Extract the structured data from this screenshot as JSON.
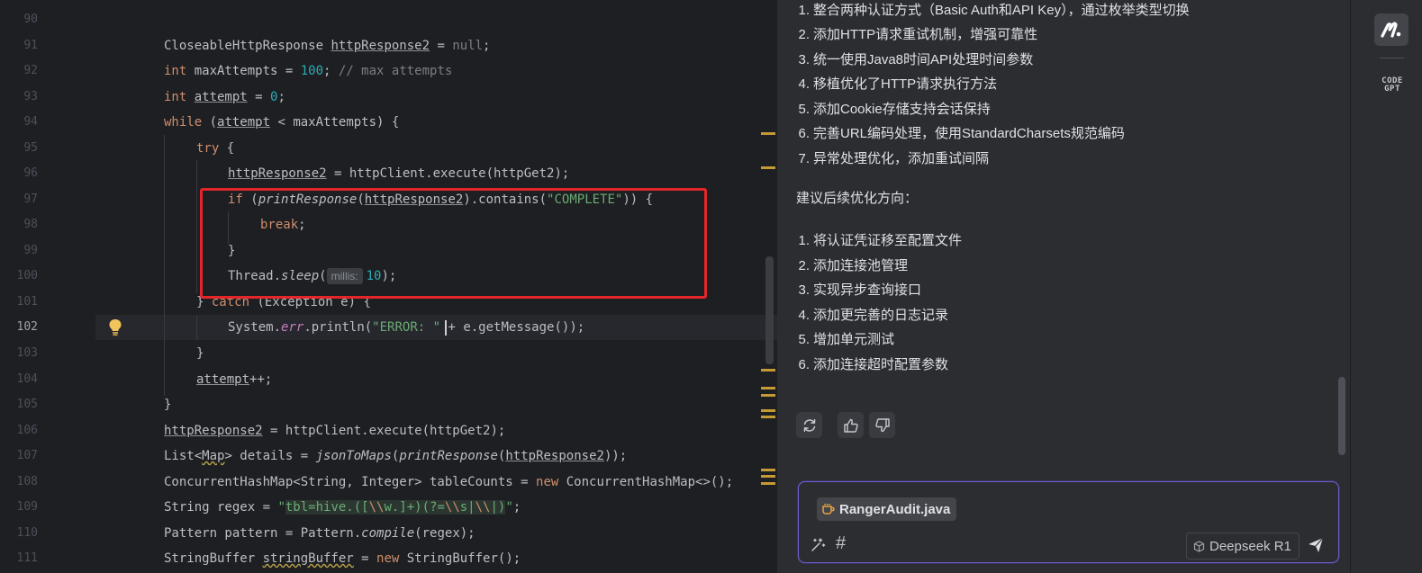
{
  "editor": {
    "line_numbers": [
      "90",
      "91",
      "92",
      "93",
      "94",
      "95",
      "96",
      "97",
      "98",
      "99",
      "100",
      "101",
      "102",
      "103",
      "104",
      "105",
      "106",
      "107",
      "108",
      "109",
      "110",
      "111"
    ],
    "current_line": "102",
    "inlay_hint": "millis:",
    "code_text": {
      "l91_type": "CloseableHttpResponse ",
      "l91_var": "httpResponse2",
      "l91_rest": " = ",
      "l91_null": "null",
      "l91_end": ";",
      "l92_kw": "int ",
      "l92_a": "maxAttempts = ",
      "l92_num": "100",
      "l92_b": "; ",
      "l92_cmt": "// max attempts",
      "l93_kw": "int ",
      "l93_var": "attempt",
      "l93_a": " = ",
      "l93_num": "0",
      "l93_b": ";",
      "l94_kw": "while ",
      "l94_a": "(",
      "l94_var": "attempt",
      "l94_b": " < maxAttempts) {",
      "l95_kw": "try ",
      "l95_a": "{",
      "l96_var": "httpResponse2",
      "l96_a": " = httpClient.execute(httpGet2);",
      "l97_kw": "if ",
      "l97_a": "(",
      "l97_fn": "printResponse",
      "l97_b": "(",
      "l97_var": "httpResponse2",
      "l97_c": ").contains(",
      "l97_str": "\"COMPLETE\"",
      "l97_d": ")) {",
      "l98_kw": "break",
      "l98_a": ";",
      "l99_a": "}",
      "l100_a": "Thread.",
      "l100_fn": "sleep",
      "l100_b": "(",
      "l100_num": "10",
      "l100_c": ");",
      "l101_a": "} ",
      "l101_kw": "catch ",
      "l101_b": "(Exception e) {",
      "l102_a": "System.",
      "l102_field": "err",
      "l102_b": ".println(",
      "l102_str": "\"ERROR: \"",
      "l102_c": " + e.getMessage());",
      "l103_a": "}",
      "l104_var": "attempt",
      "l104_a": "++;",
      "l105_a": "}",
      "l106_var": "httpResponse2",
      "l106_a": " = httpClient.execute(httpGet2);",
      "l107_a": "List<",
      "l107_map": "Map",
      "l107_b": "> details = ",
      "l107_fn1": "jsonToMaps",
      "l107_c": "(",
      "l107_fn2": "printResponse",
      "l107_d": "(",
      "l107_var": "httpResponse2",
      "l107_e": "));",
      "l108_a": "ConcurrentHashMap<String, Integer> tableCounts = ",
      "l108_kw": "new ",
      "l108_b": "ConcurrentHashMap<>();",
      "l109_a": "String regex = ",
      "l109_q1": "\"",
      "l109_r1": "tbl=hive.([",
      "l109_e1": "\\\\",
      "l109_r2": "w.]+)(?=",
      "l109_e2": "\\\\",
      "l109_r3": "s|",
      "l109_e3": "\\\\",
      "l109_r4": "|)",
      "l109_q2": "\"",
      "l109_b": ";",
      "l110_a": "Pattern pattern = Pattern.",
      "l110_fn": "compile",
      "l110_b": "(regex);",
      "l111_a": "StringBuffer ",
      "l111_var": "stringBuffer",
      "l111_b": " = ",
      "l111_kw": "new ",
      "l111_c": "StringBuffer();"
    }
  },
  "chat": {
    "summary_items": [
      {
        "n": "1.",
        "text": "整合两种认证方式（Basic Auth和API Key），通过枚举类型切换"
      },
      {
        "n": "2.",
        "text": "添加HTTP请求重试机制，增强可靠性"
      },
      {
        "n": "3.",
        "text": "统一使用Java8时间API处理时间参数"
      },
      {
        "n": "4.",
        "text": "移植优化了HTTP请求执行方法"
      },
      {
        "n": "5.",
        "text": "添加Cookie存储支持会话保持"
      },
      {
        "n": "6.",
        "text": "完善URL编码处理，使用StandardCharsets规范编码"
      },
      {
        "n": "7.",
        "text": "异常处理优化，添加重试间隔"
      }
    ],
    "suggest_heading": "建议后续优化方向：",
    "suggest_items": [
      {
        "n": "1.",
        "text": "将认证凭证移至配置文件"
      },
      {
        "n": "2.",
        "text": "添加连接池管理"
      },
      {
        "n": "3.",
        "text": "实现异步查询接口"
      },
      {
        "n": "4.",
        "text": "添加更完善的日志记录"
      },
      {
        "n": "5.",
        "text": "增加单元测试"
      },
      {
        "n": "6.",
        "text": "添加连接超时配置参数"
      }
    ],
    "actions": {
      "regenerate_icon": "refresh-icon",
      "like_icon": "thumbs-up-icon",
      "dislike_icon": "thumbs-down-icon"
    },
    "input": {
      "file_chip": "RangerAudit.java",
      "file_icon": "coffee-cup-icon",
      "model": "Deepseek R1",
      "model_icon": "cube-icon",
      "send_icon": "send-icon"
    }
  },
  "toolbar": {
    "plugin_icon_text_top": "CODE",
    "plugin_icon_text_bottom": "GPT"
  },
  "colors": {
    "editor_bg": "#1e1f22",
    "panel_bg": "#2b2d30",
    "keyword": "#cf8e6d",
    "number": "#2aacb8",
    "string": "#6aab73",
    "comment": "#7a7e85",
    "highlight_box": "#e3262a",
    "input_border": "#6c5fcf"
  }
}
